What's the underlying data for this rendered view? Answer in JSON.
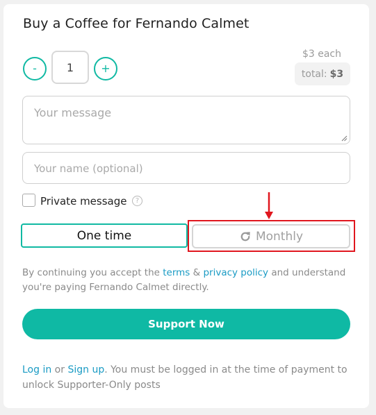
{
  "title": "Buy a Coffee for Fernando Calmet",
  "quantity": {
    "minus_label": "-",
    "value": "1",
    "plus_label": "+"
  },
  "price": {
    "each": "$3 each",
    "total_label": "total:",
    "total_value": "$3"
  },
  "message": {
    "placeholder": "Your message"
  },
  "name": {
    "placeholder": "Your name (optional)"
  },
  "private": {
    "label": "Private message",
    "checked": false,
    "help_glyph": "?"
  },
  "frequency": {
    "one_time_label": "One time",
    "monthly_label": "Monthly",
    "selected": "One time"
  },
  "consent": {
    "prefix": "By continuing you accept the ",
    "terms_link": "terms",
    "amp": " & ",
    "privacy_link": "privacy policy",
    "suffix": " and understand you're paying Fernando Calmet directly."
  },
  "support_button": "Support Now",
  "footer": {
    "login_link": "Log in",
    "or": " or ",
    "signup_link": "Sign up",
    "text": ". You must be logged in at the time of payment to unlock Supporter-Only posts"
  },
  "colors": {
    "accent": "#10b9a3",
    "link": "#1a9bc4",
    "annotation": "#e0161e"
  }
}
